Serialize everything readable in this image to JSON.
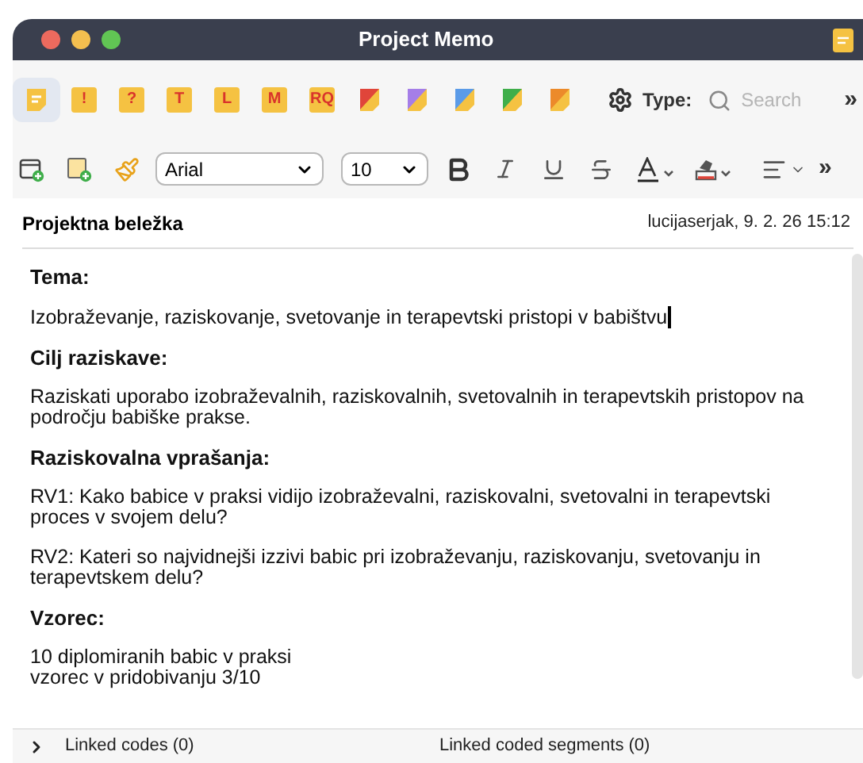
{
  "window": {
    "title": "Project Memo"
  },
  "memo_types": [
    {
      "kind": "lines",
      "selected": true,
      "color": "#f5c242"
    },
    {
      "kind": "letter",
      "label": "!",
      "selected": false,
      "color": "#f5c242"
    },
    {
      "kind": "letter",
      "label": "?",
      "selected": false,
      "color": "#f5c242"
    },
    {
      "kind": "letter",
      "label": "T",
      "selected": false,
      "color": "#f5c242"
    },
    {
      "kind": "letter",
      "label": "L",
      "selected": false,
      "color": "#f5c242"
    },
    {
      "kind": "letter",
      "label": "M",
      "selected": false,
      "color": "#f5c242"
    },
    {
      "kind": "letter",
      "label": "RQ",
      "selected": false,
      "color": "#f5c242"
    },
    {
      "kind": "corner",
      "selected": false,
      "color": "#e0453a"
    },
    {
      "kind": "corner",
      "selected": false,
      "color": "#a57ee8"
    },
    {
      "kind": "corner",
      "selected": false,
      "color": "#5b9be8"
    },
    {
      "kind": "corner",
      "selected": false,
      "color": "#3fae4a"
    },
    {
      "kind": "corner",
      "selected": false,
      "color": "#ec8a2a"
    }
  ],
  "type_label": "Type:",
  "search": {
    "placeholder": "Search"
  },
  "overflow_1": "»",
  "font": {
    "family": "Arial",
    "size": "10"
  },
  "overflow_2": "»",
  "memo": {
    "title": "Projektna beležka",
    "author_date": "lucijaserjak, 9. 2. 26 15:12"
  },
  "body": [
    {
      "kind": "heading",
      "text": "Tema:"
    },
    {
      "kind": "text",
      "text": "Izobraževanje, raziskovanje, svetovanje in terapevtski pristopi v babištvu",
      "cursor": true
    },
    {
      "kind": "heading",
      "text": "Cilj raziskave:"
    },
    {
      "kind": "text",
      "text": "Raziskati uporabo izobraževalnih, raziskovalnih, svetovalnih in terapevtskih pristopov na področju babiške prakse.",
      "cursor": false
    },
    {
      "kind": "heading",
      "text": "Raziskovalna vprašanja:"
    },
    {
      "kind": "text",
      "text": "RV1: Kako babice v praksi vidijo izobraževalni, raziskovalni, svetovalni in terapevtski proces v svojem delu?",
      "cursor": false
    },
    {
      "kind": "text",
      "text": "RV2: Kateri so najvidnejši izzivi babic pri izobraževanju, raziskovanju, svetovanju in terapevtskem delu?",
      "cursor": false
    },
    {
      "kind": "heading",
      "text": "Vzorec:"
    },
    {
      "kind": "lines",
      "lines": [
        "10 diplomiranih babic v praksi",
        "vzorec v pridobivanju 3/10"
      ]
    }
  ],
  "footer": {
    "linked_codes": "Linked codes (0)",
    "linked_segments": "Linked coded segments (0)",
    "expanded": false
  }
}
